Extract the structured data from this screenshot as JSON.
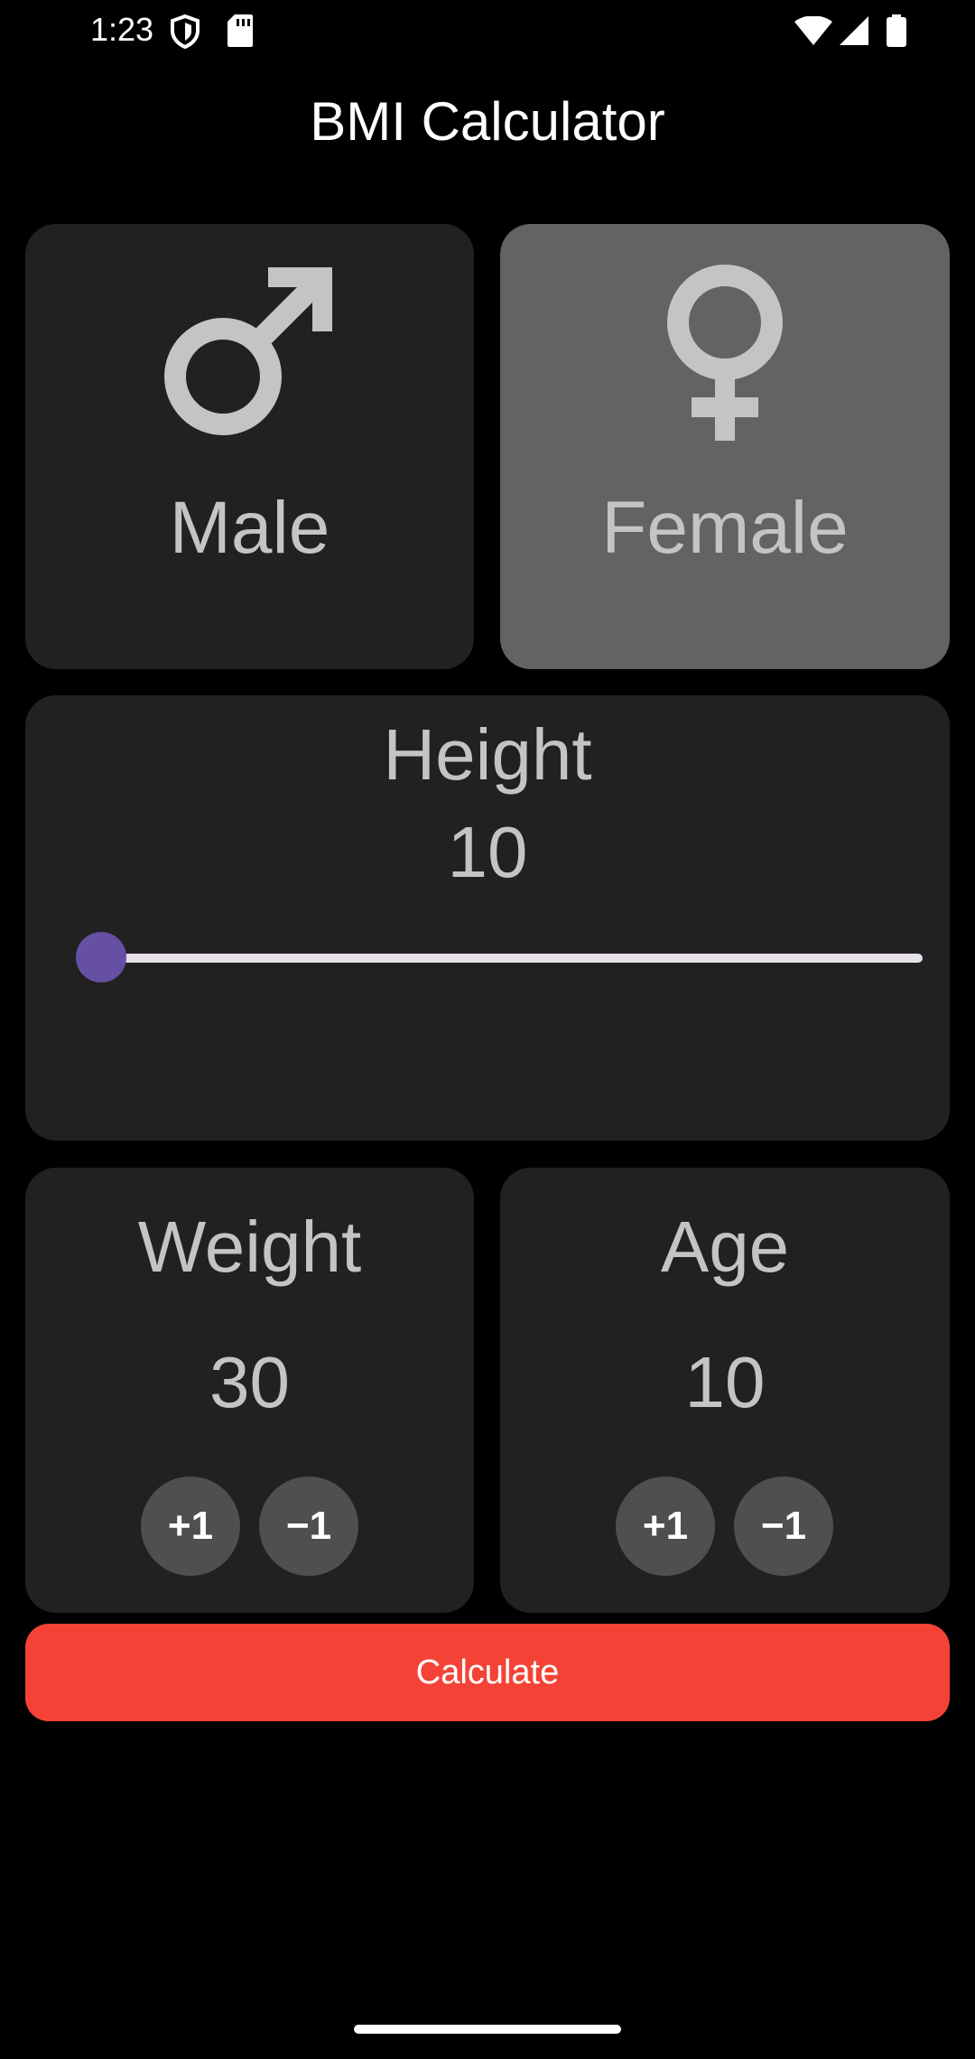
{
  "status_bar": {
    "time": "1:23",
    "icons": [
      "shield-icon",
      "sd-card-icon",
      "wifi-icon",
      "signal-icon",
      "battery-icon"
    ]
  },
  "app": {
    "title": "BMI Calculator"
  },
  "gender": {
    "male_label": "Male",
    "female_label": "Female",
    "selected": "female"
  },
  "height": {
    "label": "Height",
    "value": "10",
    "slider_fraction": 0
  },
  "weight": {
    "label": "Weight",
    "value": "30",
    "increment_label": "+1",
    "decrement_label": "−1"
  },
  "age": {
    "label": "Age",
    "value": "10",
    "increment_label": "+1",
    "decrement_label": "−1"
  },
  "calculate_label": "Calculate",
  "colors": {
    "background": "#000000",
    "card": "#212121",
    "card_selected": "#636363",
    "text_muted": "#c4c4c4",
    "slider_thumb": "#6650a4",
    "slider_track": "#e6e0e9",
    "round_button": "#4f4f4f",
    "calculate_button": "#f44336"
  }
}
